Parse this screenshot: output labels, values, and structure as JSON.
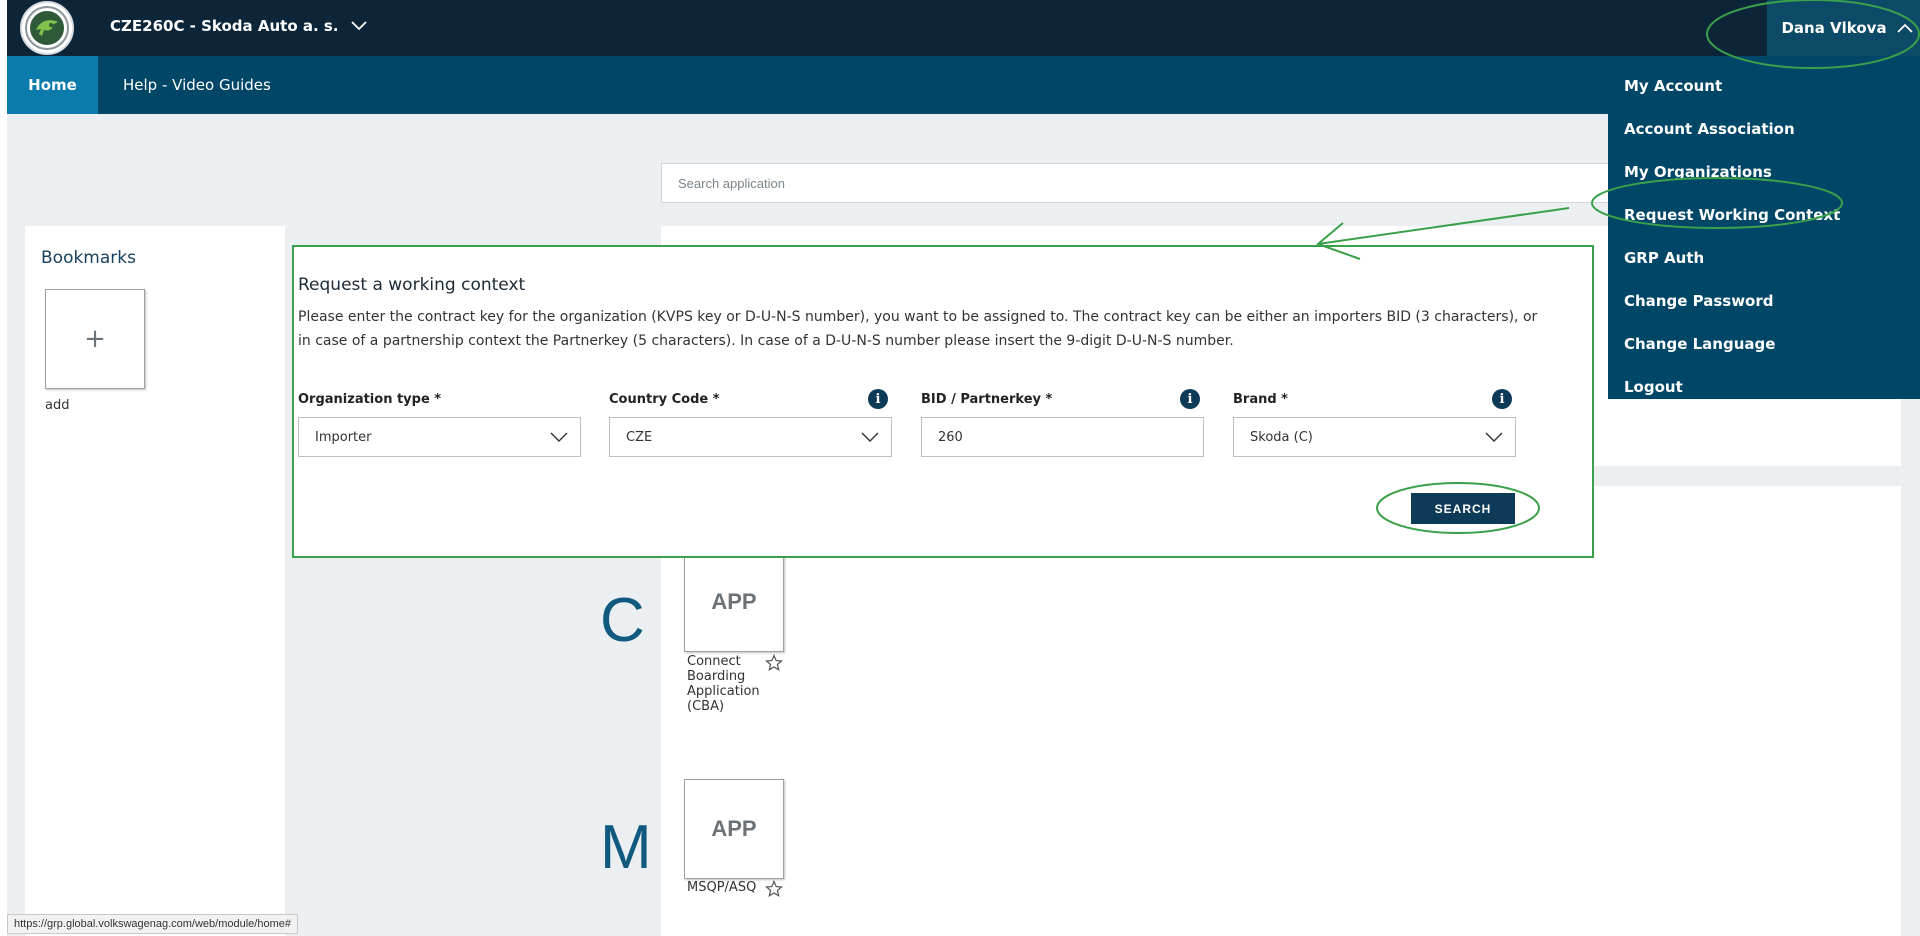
{
  "header": {
    "org_label": "CZE260C - Skoda Auto a. s.",
    "user_name": "Dana Vlkova"
  },
  "nav": {
    "home": "Home",
    "help": "Help - Video Guides"
  },
  "search": {
    "placeholder": "Search application"
  },
  "bookmarks": {
    "title": "Bookmarks",
    "add_symbol": "+",
    "add_label": "add"
  },
  "apps": [
    {
      "letter": "C",
      "tile": "APP",
      "label": "Connect Boarding Application (CBA)"
    },
    {
      "letter": "M",
      "tile": "APP",
      "label": "MSQP/ASQ"
    }
  ],
  "modal": {
    "title": "Request a working context",
    "description": "Please enter the contract key for the organization (KVPS key or D-U-N-S number), you want to be assigned to. The contract key can be either an importers BID (3 characters), or in case of a partnership context the Partnerkey (5 characters). In case of a D-U-N-S number please insert the 9-digit D-U-N-S number.",
    "fields": [
      {
        "label": "Organization type *",
        "value": "Importer"
      },
      {
        "label": "Country Code *",
        "value": "CZE"
      },
      {
        "label": "BID / Partnerkey *",
        "value": "260"
      },
      {
        "label": "Brand *",
        "value": "Skoda (C)"
      }
    ],
    "info_symbol": "i",
    "search_button": "SEARCH"
  },
  "user_menu": [
    "My Account",
    "Account Association",
    "My Organizations",
    "Request Working Context",
    "GRP Auth",
    "Change Password",
    "Change Language",
    "Logout"
  ],
  "status_url": "https://grp.global.volkswagenag.com/web/module/home#",
  "colors": {
    "header_bg": "#0d2538",
    "nav_bg": "#004666",
    "active_tab": "#0b7bab",
    "annotation_green": "#3aa04a"
  }
}
